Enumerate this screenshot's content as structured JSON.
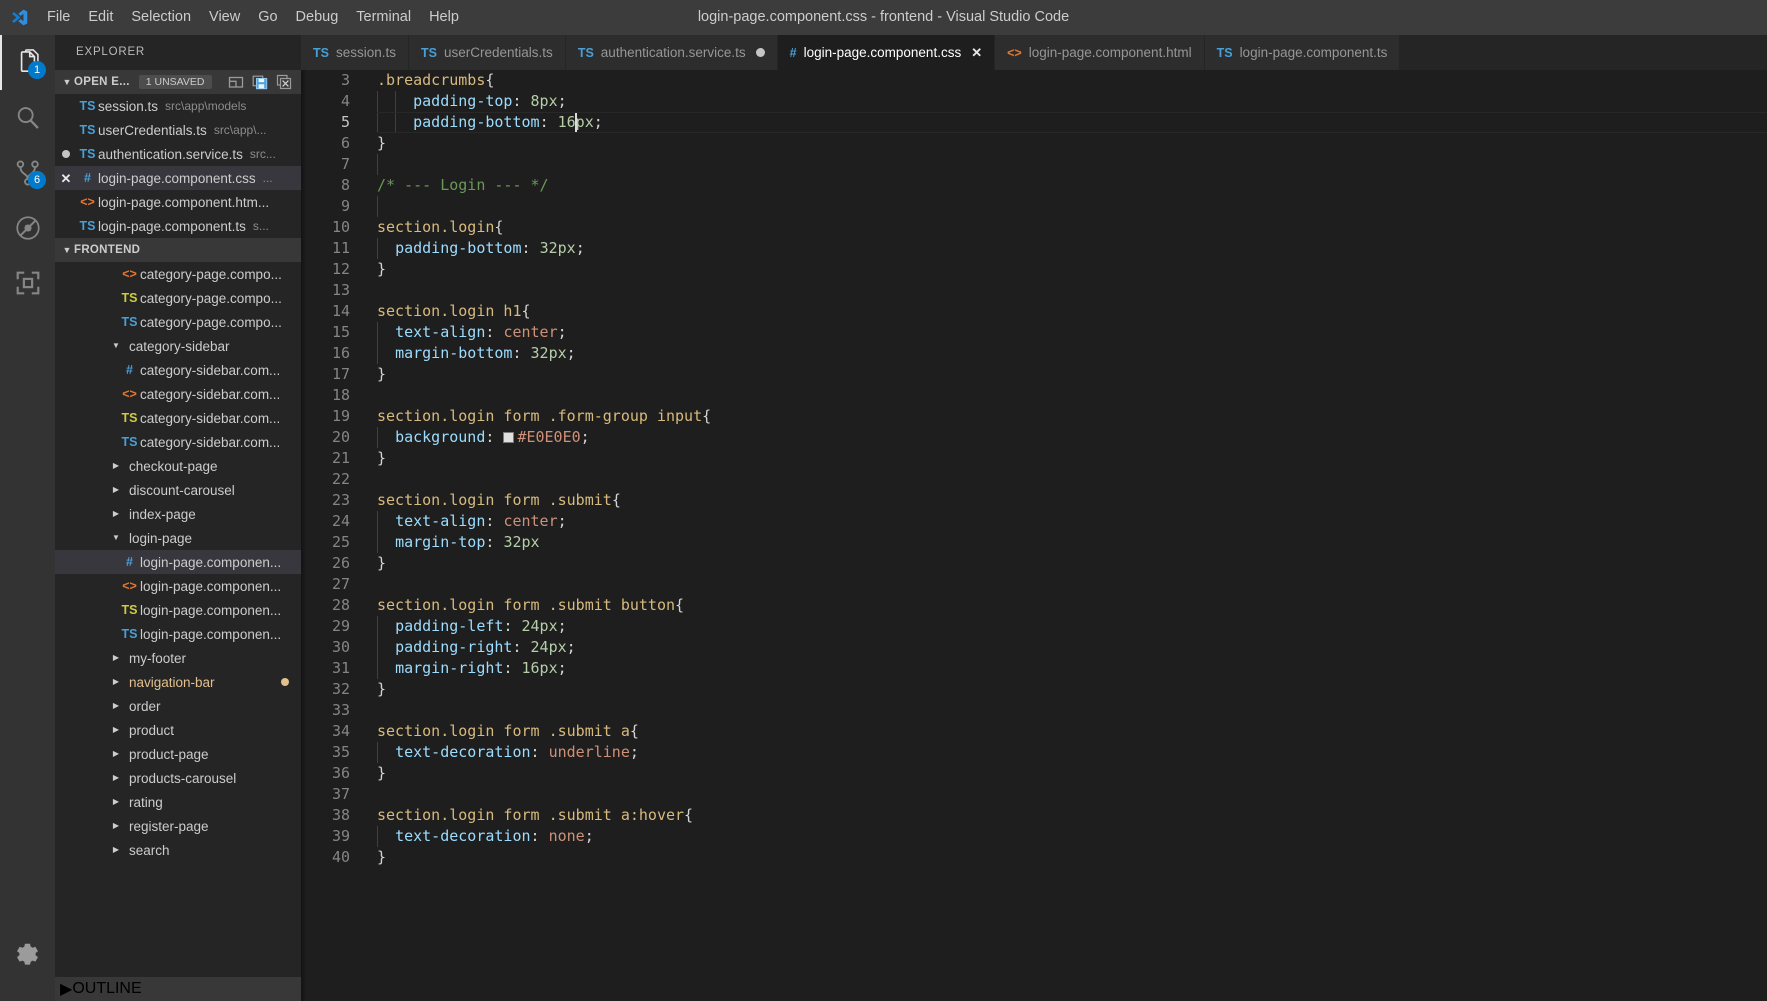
{
  "window": {
    "title": "login-page.component.css - frontend - Visual Studio Code",
    "logo_icon": "vscode-logo-icon"
  },
  "menubar": {
    "items": [
      {
        "label": "File"
      },
      {
        "label": "Edit"
      },
      {
        "label": "Selection"
      },
      {
        "label": "View"
      },
      {
        "label": "Go"
      },
      {
        "label": "Debug"
      },
      {
        "label": "Terminal"
      },
      {
        "label": "Help"
      }
    ]
  },
  "activitybar": {
    "items": [
      {
        "name": "explorer",
        "icon": "files-icon",
        "badge": "1",
        "active": true
      },
      {
        "name": "search",
        "icon": "search-icon",
        "badge": "",
        "active": false
      },
      {
        "name": "source-control",
        "icon": "source-control-icon",
        "badge": "6",
        "active": false
      },
      {
        "name": "debug",
        "icon": "no-debug-icon",
        "badge": "",
        "active": false
      },
      {
        "name": "extensions",
        "icon": "extensions-icon",
        "badge": "",
        "active": false
      }
    ],
    "bottom": [
      {
        "name": "manage",
        "icon": "gear-icon"
      }
    ]
  },
  "sidebar": {
    "title": "EXPLORER",
    "open_editors": {
      "label": "OPEN E...",
      "unsaved_badge": "1 UNSAVED",
      "actions": [
        {
          "name": "save-all-icon"
        },
        {
          "name": "split-editor-icon"
        },
        {
          "name": "close-all-editors-icon"
        }
      ],
      "files": [
        {
          "lead": "none",
          "icon": "TS",
          "icon_kind": "ts",
          "name": "session.ts",
          "path": "src\\app\\models"
        },
        {
          "lead": "none",
          "icon": "TS",
          "icon_kind": "ts",
          "name": "userCredentials.ts",
          "path": "src\\app\\..."
        },
        {
          "lead": "dot",
          "icon": "TS",
          "icon_kind": "ts",
          "name": "authentication.service.ts",
          "path": "src...",
          "dirty": true
        },
        {
          "lead": "close",
          "icon": "#",
          "icon_kind": "css",
          "name": "login-page.component.css",
          "path": "...",
          "selected": true
        },
        {
          "lead": "none",
          "icon": "<>",
          "icon_kind": "html",
          "name": "login-page.component.htm...",
          "path": ""
        },
        {
          "lead": "none",
          "icon": "TS",
          "icon_kind": "ts",
          "name": "login-page.component.ts",
          "path": "s..."
        }
      ]
    },
    "project": {
      "label": "FRONTEND",
      "items": [
        {
          "type": "file",
          "depth": 3,
          "icon": "<>",
          "icon_kind": "html",
          "name": "category-page.compo..."
        },
        {
          "type": "file",
          "depth": 3,
          "icon": "TS",
          "icon_kind": "ts-yellow",
          "name": "category-page.compo..."
        },
        {
          "type": "file",
          "depth": 3,
          "icon": "TS",
          "icon_kind": "ts",
          "name": "category-page.compo..."
        },
        {
          "type": "folder",
          "depth": 2,
          "expanded": true,
          "name": "category-sidebar"
        },
        {
          "type": "file",
          "depth": 3,
          "icon": "#",
          "icon_kind": "css",
          "name": "category-sidebar.com..."
        },
        {
          "type": "file",
          "depth": 3,
          "icon": "<>",
          "icon_kind": "html",
          "name": "category-sidebar.com..."
        },
        {
          "type": "file",
          "depth": 3,
          "icon": "TS",
          "icon_kind": "ts-yellow",
          "name": "category-sidebar.com..."
        },
        {
          "type": "file",
          "depth": 3,
          "icon": "TS",
          "icon_kind": "ts",
          "name": "category-sidebar.com..."
        },
        {
          "type": "folder",
          "depth": 2,
          "expanded": false,
          "name": "checkout-page"
        },
        {
          "type": "folder",
          "depth": 2,
          "expanded": false,
          "name": "discount-carousel"
        },
        {
          "type": "folder",
          "depth": 2,
          "expanded": false,
          "name": "index-page"
        },
        {
          "type": "folder",
          "depth": 2,
          "expanded": true,
          "name": "login-page"
        },
        {
          "type": "file",
          "depth": 3,
          "icon": "#",
          "icon_kind": "css",
          "name": "login-page.componen...",
          "selected": true
        },
        {
          "type": "file",
          "depth": 3,
          "icon": "<>",
          "icon_kind": "html",
          "name": "login-page.componen..."
        },
        {
          "type": "file",
          "depth": 3,
          "icon": "TS",
          "icon_kind": "ts-yellow",
          "name": "login-page.componen..."
        },
        {
          "type": "file",
          "depth": 3,
          "icon": "TS",
          "icon_kind": "ts",
          "name": "login-page.componen..."
        },
        {
          "type": "folder",
          "depth": 2,
          "expanded": false,
          "name": "my-footer"
        },
        {
          "type": "folder",
          "depth": 2,
          "expanded": false,
          "name": "navigation-bar",
          "git_modified": true
        },
        {
          "type": "folder",
          "depth": 2,
          "expanded": false,
          "name": "order"
        },
        {
          "type": "folder",
          "depth": 2,
          "expanded": false,
          "name": "product"
        },
        {
          "type": "folder",
          "depth": 2,
          "expanded": false,
          "name": "product-page"
        },
        {
          "type": "folder",
          "depth": 2,
          "expanded": false,
          "name": "products-carousel"
        },
        {
          "type": "folder",
          "depth": 2,
          "expanded": false,
          "name": "rating"
        },
        {
          "type": "folder",
          "depth": 2,
          "expanded": false,
          "name": "register-page"
        },
        {
          "type": "folder",
          "depth": 2,
          "expanded": false,
          "name": "search"
        }
      ]
    },
    "outline": {
      "label": "OUTLINE",
      "expanded": false
    }
  },
  "tabs": [
    {
      "icon": "TS",
      "icon_kind": "ts",
      "label": "session.ts",
      "active": false,
      "dirty": false,
      "closable": false
    },
    {
      "icon": "TS",
      "icon_kind": "ts",
      "label": "userCredentials.ts",
      "active": false,
      "dirty": false,
      "closable": false
    },
    {
      "icon": "TS",
      "icon_kind": "ts",
      "label": "authentication.service.ts",
      "active": false,
      "dirty": true,
      "closable": false
    },
    {
      "icon": "#",
      "icon_kind": "css",
      "label": "login-page.component.css",
      "active": true,
      "dirty": false,
      "closable": true
    },
    {
      "icon": "<>",
      "icon_kind": "html",
      "label": "login-page.component.html",
      "active": false,
      "dirty": false,
      "closable": false
    },
    {
      "icon": "TS",
      "icon_kind": "ts",
      "label": "login-page.component.ts",
      "active": false,
      "dirty": false,
      "closable": false
    }
  ],
  "editor": {
    "language": "css",
    "first_visible_line": 3,
    "last_visible_line": 40,
    "cursor": {
      "line": 5,
      "column": 21,
      "text_before": "    padding-bottom: 16"
    },
    "color_swatch": "#E0E0E0",
    "lines": [
      {
        "n": 3,
        "text": ".breadcrumbs{"
      },
      {
        "n": 4,
        "text": "    padding-top: 8px;"
      },
      {
        "n": 5,
        "text": "    padding-bottom: 16px;"
      },
      {
        "n": 6,
        "text": "}"
      },
      {
        "n": 7,
        "text": ""
      },
      {
        "n": 8,
        "text": "/* --- Login --- */"
      },
      {
        "n": 9,
        "text": ""
      },
      {
        "n": 10,
        "text": "section.login{"
      },
      {
        "n": 11,
        "text": "  padding-bottom: 32px;"
      },
      {
        "n": 12,
        "text": "}"
      },
      {
        "n": 13,
        "text": ""
      },
      {
        "n": 14,
        "text": "section.login h1{"
      },
      {
        "n": 15,
        "text": "  text-align: center;"
      },
      {
        "n": 16,
        "text": "  margin-bottom: 32px;"
      },
      {
        "n": 17,
        "text": "}"
      },
      {
        "n": 18,
        "text": ""
      },
      {
        "n": 19,
        "text": "section.login form .form-group input{"
      },
      {
        "n": 20,
        "text": "  background: #E0E0E0;"
      },
      {
        "n": 21,
        "text": "}"
      },
      {
        "n": 22,
        "text": ""
      },
      {
        "n": 23,
        "text": "section.login form .submit{"
      },
      {
        "n": 24,
        "text": "  text-align: center;"
      },
      {
        "n": 25,
        "text": "  margin-top: 32px"
      },
      {
        "n": 26,
        "text": "}"
      },
      {
        "n": 27,
        "text": ""
      },
      {
        "n": 28,
        "text": "section.login form .submit button{"
      },
      {
        "n": 29,
        "text": "  padding-left: 24px;"
      },
      {
        "n": 30,
        "text": "  padding-right: 24px;"
      },
      {
        "n": 31,
        "text": "  margin-right: 16px;"
      },
      {
        "n": 32,
        "text": "}"
      },
      {
        "n": 33,
        "text": ""
      },
      {
        "n": 34,
        "text": "section.login form .submit a{"
      },
      {
        "n": 35,
        "text": "  text-decoration: underline;"
      },
      {
        "n": 36,
        "text": "}"
      },
      {
        "n": 37,
        "text": ""
      },
      {
        "n": 38,
        "text": "section.login form .submit a:hover{"
      },
      {
        "n": 39,
        "text": "  text-decoration: none;"
      },
      {
        "n": 40,
        "text": "}"
      }
    ]
  },
  "colors": {
    "accent": "#007acc",
    "titlebar_bg": "#3c3c3c",
    "sidebar_bg": "#252526",
    "editor_bg": "#1e1e1e",
    "activitybar_bg": "#333333",
    "selection_bg": "#37373d",
    "git_modified": "#e2c08d"
  }
}
